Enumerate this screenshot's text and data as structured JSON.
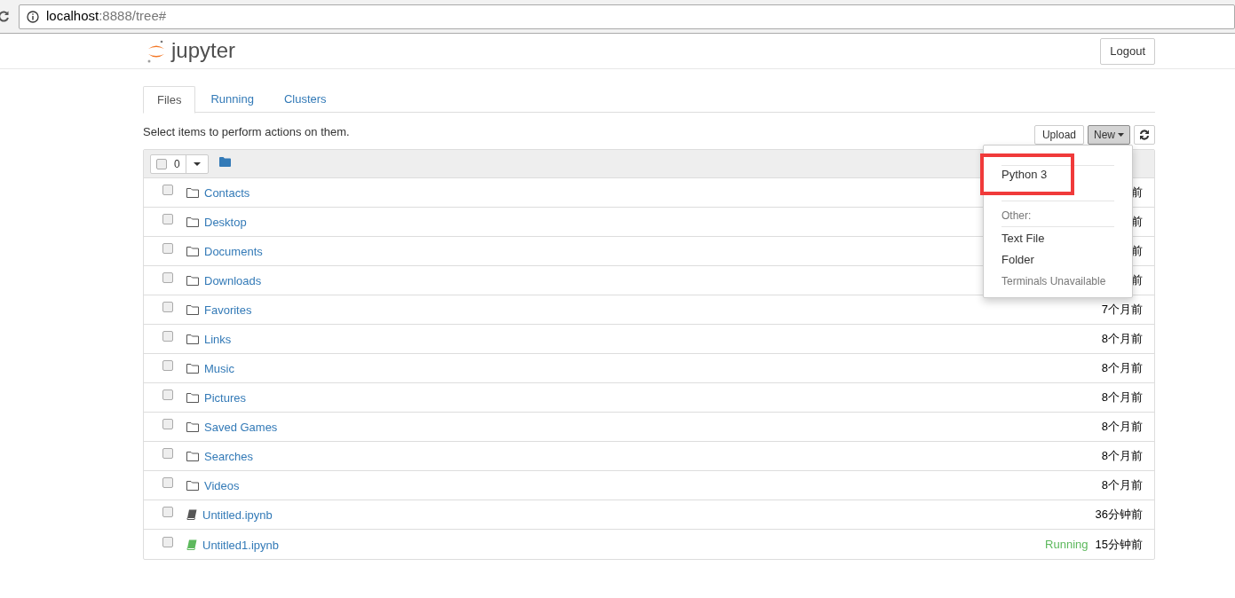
{
  "browser": {
    "url_host": "localhost",
    "url_path": ":8888/tree#"
  },
  "header": {
    "logo": "jupyter",
    "logout": "Logout"
  },
  "tabs": [
    {
      "label": "Files",
      "selected": true
    },
    {
      "label": "Running",
      "selected": false
    },
    {
      "label": "Clusters",
      "selected": false
    }
  ],
  "instructions": "Select items to perform actions on them.",
  "toolbar": {
    "upload": "Upload",
    "new": "New",
    "new_open": true
  },
  "list_header": {
    "selected_count": "0",
    "checked": false
  },
  "rows": [
    {
      "name": "Contacts",
      "kind": "folder",
      "modified": "前",
      "checked": false
    },
    {
      "name": "Desktop",
      "kind": "folder",
      "modified": "前",
      "checked": false
    },
    {
      "name": "Documents",
      "kind": "folder",
      "modified": "前",
      "checked": false
    },
    {
      "name": "Downloads",
      "kind": "folder",
      "modified": "前",
      "checked": false
    },
    {
      "name": "Favorites",
      "kind": "folder",
      "modified": "7个月前",
      "checked": false
    },
    {
      "name": "Links",
      "kind": "folder",
      "modified": "8个月前",
      "checked": false
    },
    {
      "name": "Music",
      "kind": "folder",
      "modified": "8个月前",
      "checked": false
    },
    {
      "name": "Pictures",
      "kind": "folder",
      "modified": "8个月前",
      "checked": false
    },
    {
      "name": "Saved Games",
      "kind": "folder",
      "modified": "8个月前",
      "checked": false
    },
    {
      "name": "Searches",
      "kind": "folder",
      "modified": "8个月前",
      "checked": false
    },
    {
      "name": "Videos",
      "kind": "folder",
      "modified": "8个月前",
      "checked": false
    },
    {
      "name": "Untitled.ipynb",
      "kind": "notebook",
      "modified": "36分钟前",
      "checked": false
    },
    {
      "name": "Untitled1.ipynb",
      "kind": "notebook",
      "modified": "15分钟前",
      "checked": false,
      "status": "Running"
    }
  ],
  "new_menu": [
    {
      "kind": "item",
      "label": "Python 3",
      "highlighted": true
    },
    {
      "kind": "header",
      "label": "Other:"
    },
    {
      "kind": "item",
      "label": "Text File",
      "highlighted": false
    },
    {
      "kind": "item",
      "label": "Folder",
      "highlighted": false
    },
    {
      "kind": "disabled",
      "label": "Terminals Unavailable",
      "highlighted": false
    }
  ]
}
